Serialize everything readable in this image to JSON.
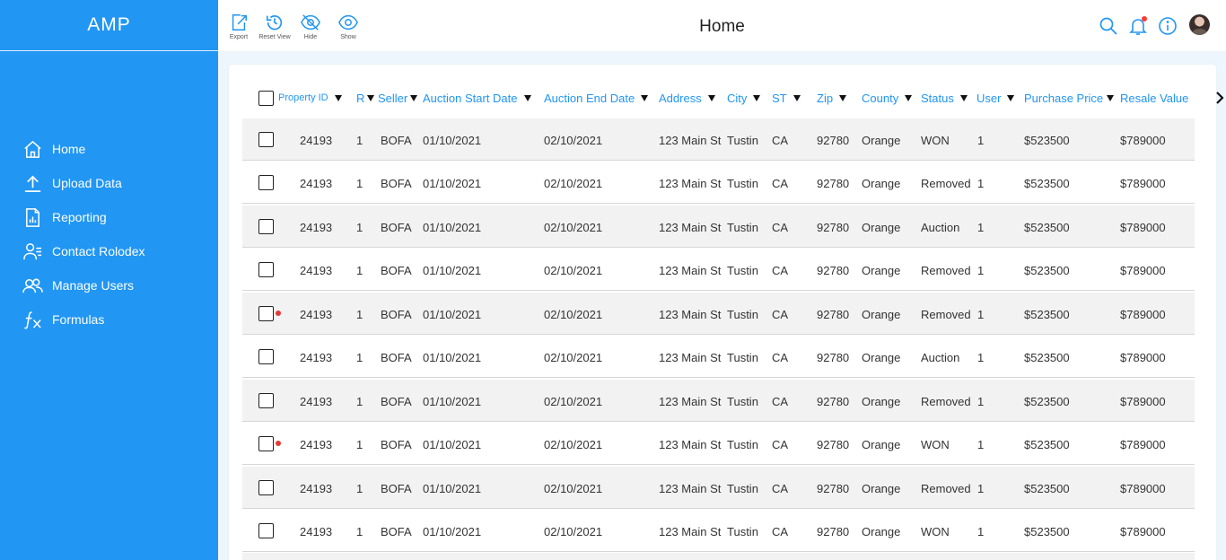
{
  "app": {
    "brand": "AMP"
  },
  "sidebar": {
    "items": [
      {
        "label": "Home",
        "icon": "home-icon"
      },
      {
        "label": "Upload Data",
        "icon": "upload-icon"
      },
      {
        "label": "Reporting",
        "icon": "report-icon"
      },
      {
        "label": "Contact Rolodex",
        "icon": "contacts-icon"
      },
      {
        "label": "Manage Users",
        "icon": "users-icon"
      },
      {
        "label": "Formulas",
        "icon": "function-icon"
      }
    ]
  },
  "toolbar": {
    "export_label": "Export",
    "reset_label": "Reset View",
    "hide_label": "Hide",
    "show_label": "Show"
  },
  "header": {
    "title": "Home"
  },
  "colors": {
    "accent": "#2196f3",
    "badge": "#e53935",
    "row_alt": "#f2f2f2"
  },
  "table": {
    "columns": [
      "Property ID",
      "R",
      "Seller",
      "Auction Start Date",
      "Auction End Date",
      "Address",
      "City",
      "ST",
      "Zip",
      "County",
      "Status",
      "User",
      "Purchase Price",
      "Resale Value"
    ],
    "rows": [
      {
        "flag": false,
        "cells": [
          "24193",
          "1",
          "BOFA",
          "01/10/2021",
          "02/10/2021",
          "123 Main St",
          "Tustin",
          "CA",
          "92780",
          "Orange",
          "WON",
          "1",
          "$523500",
          "$789000"
        ]
      },
      {
        "flag": false,
        "cells": [
          "24193",
          "1",
          "BOFA",
          "01/10/2021",
          "02/10/2021",
          "123 Main St",
          "Tustin",
          "CA",
          "92780",
          "Orange",
          "Removed",
          "1",
          "$523500",
          "$789000"
        ]
      },
      {
        "flag": false,
        "cells": [
          "24193",
          "1",
          "BOFA",
          "01/10/2021",
          "02/10/2021",
          "123 Main St",
          "Tustin",
          "CA",
          "92780",
          "Orange",
          "Auction",
          "1",
          "$523500",
          "$789000"
        ]
      },
      {
        "flag": false,
        "cells": [
          "24193",
          "1",
          "BOFA",
          "01/10/2021",
          "02/10/2021",
          "123 Main St",
          "Tustin",
          "CA",
          "92780",
          "Orange",
          "Removed",
          "1",
          "$523500",
          "$789000"
        ]
      },
      {
        "flag": true,
        "cells": [
          "24193",
          "1",
          "BOFA",
          "01/10/2021",
          "02/10/2021",
          "123 Main St",
          "Tustin",
          "CA",
          "92780",
          "Orange",
          "Removed",
          "1",
          "$523500",
          "$789000"
        ]
      },
      {
        "flag": false,
        "cells": [
          "24193",
          "1",
          "BOFA",
          "01/10/2021",
          "02/10/2021",
          "123 Main St",
          "Tustin",
          "CA",
          "92780",
          "Orange",
          "Auction",
          "1",
          "$523500",
          "$789000"
        ]
      },
      {
        "flag": false,
        "cells": [
          "24193",
          "1",
          "BOFA",
          "01/10/2021",
          "02/10/2021",
          "123 Main St",
          "Tustin",
          "CA",
          "92780",
          "Orange",
          "Removed",
          "1",
          "$523500",
          "$789000"
        ]
      },
      {
        "flag": true,
        "cells": [
          "24193",
          "1",
          "BOFA",
          "01/10/2021",
          "02/10/2021",
          "123 Main St",
          "Tustin",
          "CA",
          "92780",
          "Orange",
          "WON",
          "1",
          "$523500",
          "$789000"
        ]
      },
      {
        "flag": false,
        "cells": [
          "24193",
          "1",
          "BOFA",
          "01/10/2021",
          "02/10/2021",
          "123 Main St",
          "Tustin",
          "CA",
          "92780",
          "Orange",
          "Removed",
          "1",
          "$523500",
          "$789000"
        ]
      },
      {
        "flag": false,
        "cells": [
          "24193",
          "1",
          "BOFA",
          "01/10/2021",
          "02/10/2021",
          "123 Main St",
          "Tustin",
          "CA",
          "92780",
          "Orange",
          "WON",
          "1",
          "$523500",
          "$789000"
        ]
      }
    ]
  }
}
